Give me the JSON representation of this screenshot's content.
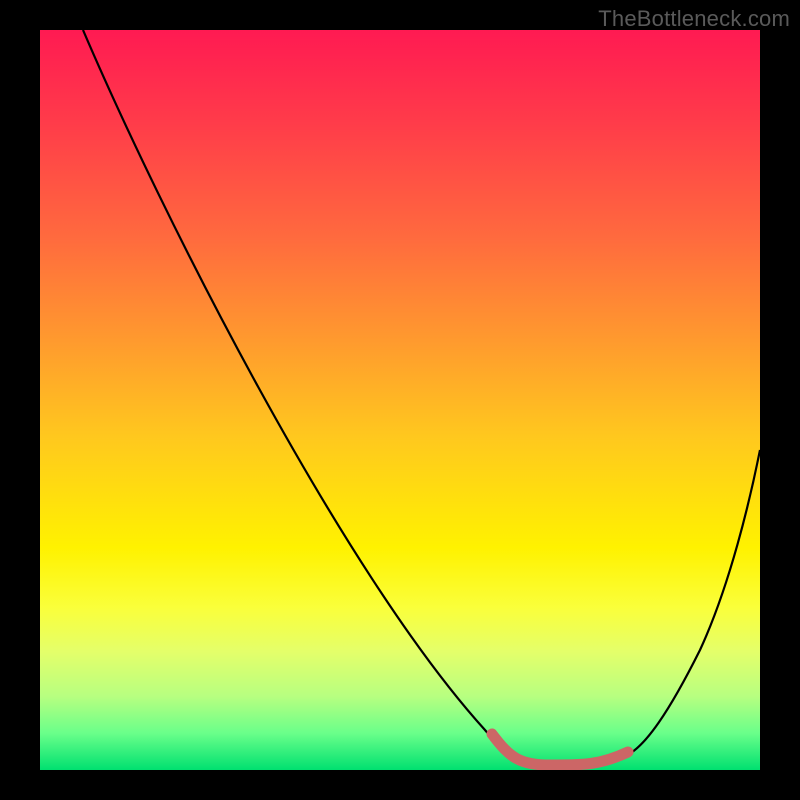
{
  "watermark": "TheBottleneck.com",
  "chart_data": {
    "type": "line",
    "title": "",
    "xlabel": "",
    "ylabel": "",
    "xlim": [
      0,
      100
    ],
    "ylim": [
      0,
      100
    ],
    "grid": false,
    "legend": false,
    "background_gradient": [
      "#ff1a52",
      "#ff6a3e",
      "#ffc81e",
      "#fff200",
      "#00e070"
    ],
    "series": [
      {
        "name": "bottleneck-curve",
        "color": "#000000",
        "x": [
          6,
          10,
          20,
          30,
          40,
          50,
          60,
          66,
          70,
          76,
          80,
          84,
          88,
          92,
          96,
          100
        ],
        "y": [
          100,
          94,
          79,
          64,
          49,
          35,
          19,
          8,
          3,
          1,
          1,
          3,
          11,
          23,
          35,
          47
        ]
      },
      {
        "name": "optimal-band",
        "color": "#cc6666",
        "x": [
          66,
          70,
          74,
          78,
          82,
          84
        ],
        "y": [
          6,
          2,
          1,
          1,
          2,
          4
        ]
      }
    ],
    "annotations": []
  }
}
